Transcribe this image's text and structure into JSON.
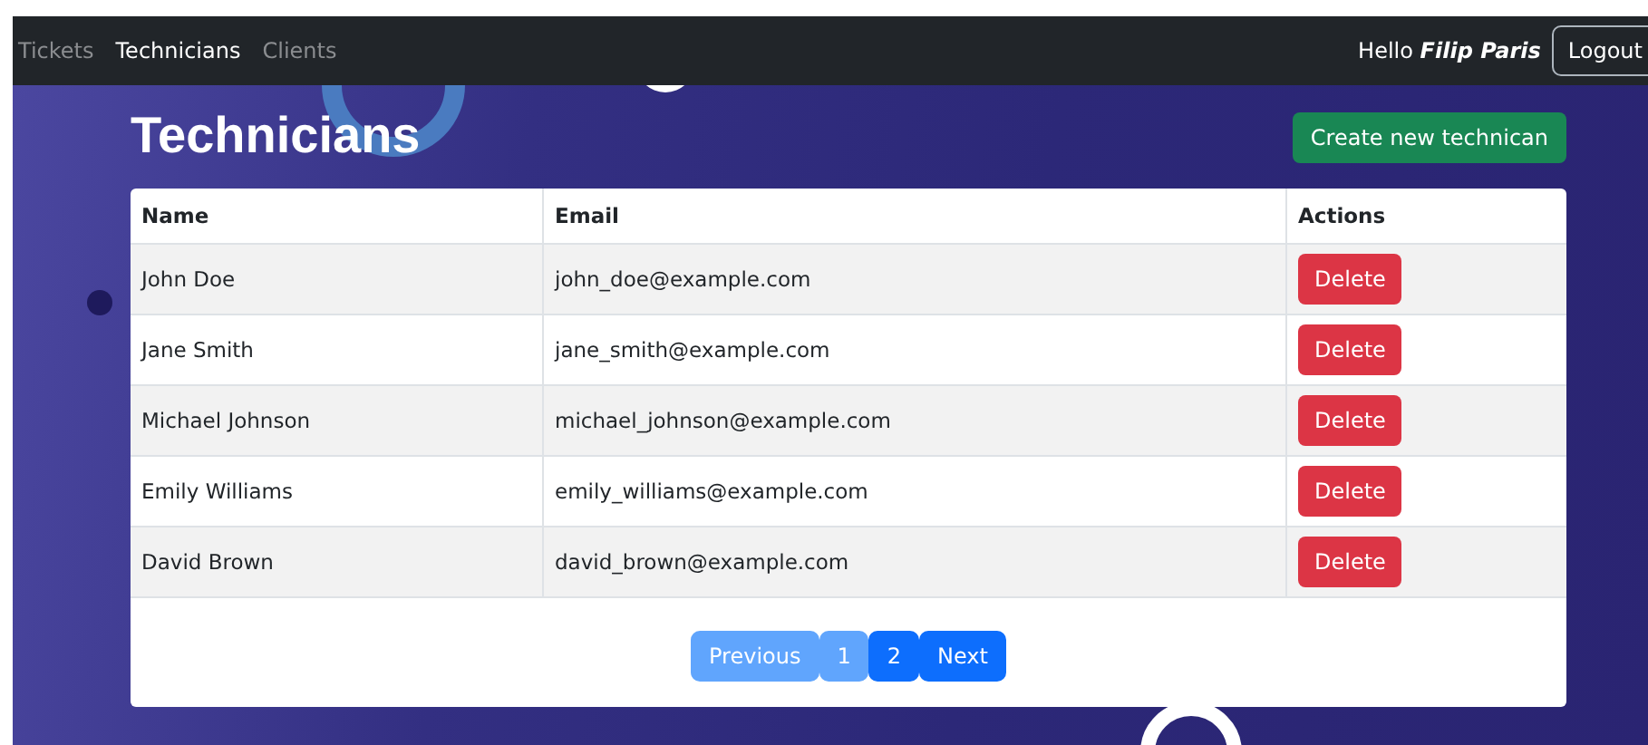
{
  "nav": {
    "links": [
      {
        "label": "Tickets",
        "selected": false
      },
      {
        "label": "Technicians",
        "selected": true
      },
      {
        "label": "Clients",
        "selected": false
      }
    ],
    "greeting": "Hello",
    "user": "Filip Paris",
    "logout": "Logout"
  },
  "title": "Technicians",
  "create_button": "Create new technican",
  "table": {
    "columns": [
      "Name",
      "Email",
      "Actions"
    ],
    "rows": [
      {
        "name": "John Doe",
        "email": "john_doe@example.com",
        "action": "Delete"
      },
      {
        "name": "Jane Smith",
        "email": "jane_smith@example.com",
        "action": "Delete"
      },
      {
        "name": "Michael Johnson",
        "email": "michael_johnson@example.com",
        "action": "Delete"
      },
      {
        "name": "Emily Williams",
        "email": "emily_williams@example.com",
        "action": "Delete"
      },
      {
        "name": "David Brown",
        "email": "david_brown@example.com",
        "action": "Delete"
      }
    ]
  },
  "pagination": {
    "previous": {
      "label": "Previous",
      "disabled": true
    },
    "pages": [
      {
        "label": "1",
        "selected": true
      },
      {
        "label": "2",
        "selected": false
      }
    ],
    "next": {
      "label": "Next",
      "disabled": false
    }
  }
}
